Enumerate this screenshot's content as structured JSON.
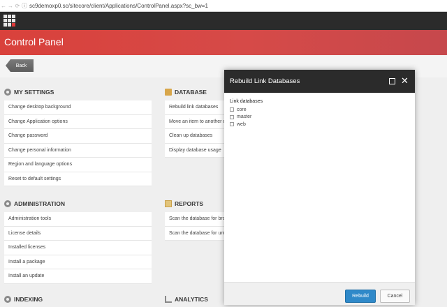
{
  "browser": {
    "back": "←",
    "forward": "→",
    "reload": "⟳",
    "info": "ⓘ",
    "url": "sc9demoxp0.sc/sitecore/client/Applications/ControlPanel.aspx?sc_bw=1"
  },
  "header": {
    "title": "Control Panel"
  },
  "back_label": "Back",
  "sections": {
    "my_settings": {
      "title": "MY SETTINGS",
      "items": [
        "Change desktop background",
        "Change Application options",
        "Change password",
        "Change personal information",
        "Region and language options",
        "Reset to default settings"
      ]
    },
    "database": {
      "title": "DATABASE",
      "items": [
        "Rebuild link databases",
        "Move an item to another d",
        "Clean up databases",
        "Display database usage"
      ]
    },
    "administration": {
      "title": "ADMINISTRATION",
      "items": [
        "Administration tools",
        "License details",
        "Installed licenses",
        "Install a package",
        "Install an update"
      ]
    },
    "reports": {
      "title": "REPORTS",
      "items": [
        "Scan the database for bro",
        "Scan the database for unt"
      ]
    },
    "indexing": {
      "title": "INDEXING"
    },
    "analytics": {
      "title": "ANALYTICS"
    }
  },
  "dialog": {
    "title": "Rebuild Link Databases",
    "field_label": "Link databases",
    "options": [
      "core",
      "master",
      "web"
    ],
    "rebuild_label": "Rebuild",
    "cancel_label": "Cancel",
    "close_glyph": "✕"
  }
}
